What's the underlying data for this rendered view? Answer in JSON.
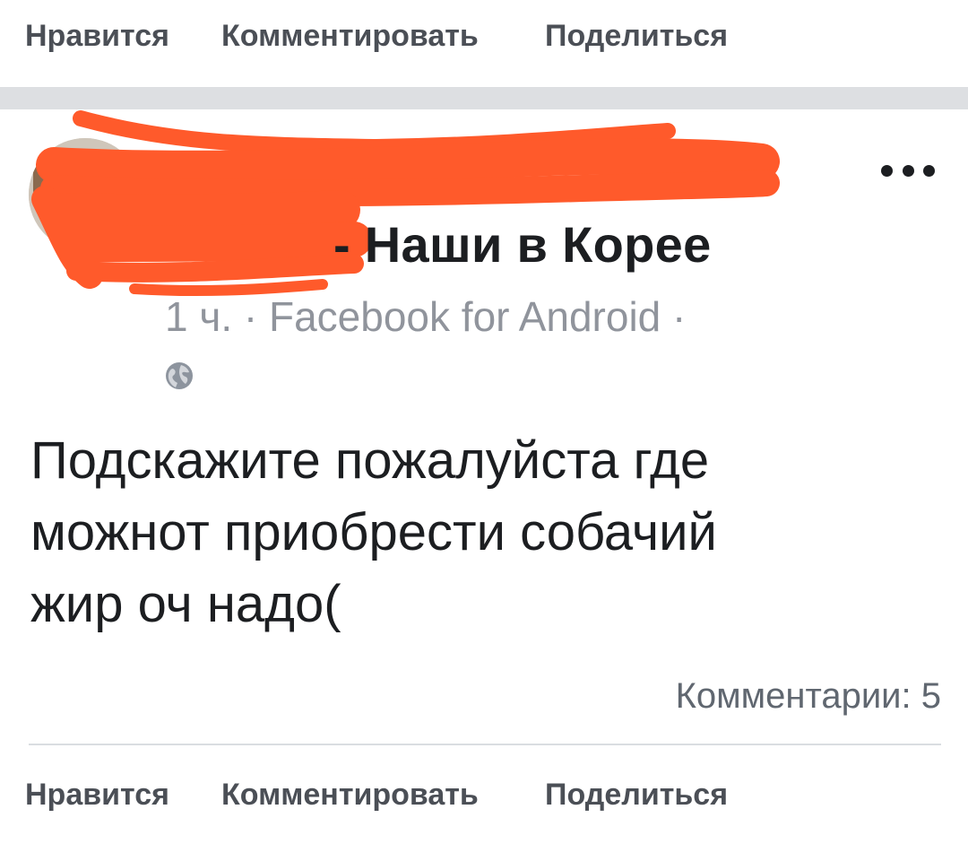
{
  "top_actions": {
    "like": "Нравится",
    "comment": "Комментировать",
    "share": "Поделиться"
  },
  "post": {
    "group_name_visible": "- Наши в Корее",
    "meta": "1 ч. · Facebook for Android ·",
    "privacy_icon": "globe-icon",
    "more_icon": "more-dots-icon",
    "text_lines": [
      "Подскажите пожалуйста где",
      "можнот приобрести собачий",
      "жир оч надо("
    ],
    "comments_count": "Комментарии: 5",
    "redaction_color": "#ff5a2b"
  },
  "bottom_actions": {
    "like": "Нравится",
    "comment": "Комментировать",
    "share": "Поделиться"
  }
}
